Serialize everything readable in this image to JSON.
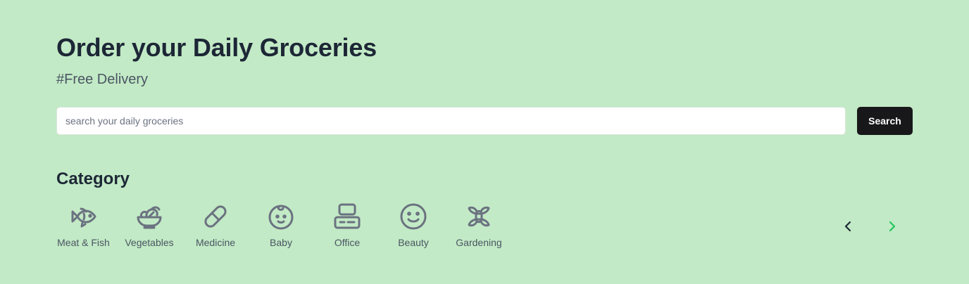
{
  "hero": {
    "title": "Order your Daily Groceries",
    "subtitle": "#Free Delivery"
  },
  "search": {
    "placeholder": "search your daily groceries",
    "value": "",
    "button_label": "Search"
  },
  "categories": {
    "heading": "Category",
    "items": [
      {
        "label": "Meat & Fish",
        "icon": "fish-icon"
      },
      {
        "label": "Vegetables",
        "icon": "salad-bowl-icon"
      },
      {
        "label": "Medicine",
        "icon": "pill-icon"
      },
      {
        "label": "Baby",
        "icon": "baby-face-icon"
      },
      {
        "label": "Office",
        "icon": "office-desk-icon"
      },
      {
        "label": "Beauty",
        "icon": "smiley-icon"
      },
      {
        "label": "Gardening",
        "icon": "flower-icon"
      }
    ],
    "nav": {
      "prev_icon": "chevron-left-icon",
      "next_icon": "chevron-right-icon"
    }
  },
  "colors": {
    "background": "#c2eac6",
    "heading": "#1d2736",
    "muted_text": "#4b5563",
    "icon": "#6b7280",
    "button_bg": "#18181b",
    "next_arrow": "#22c55e",
    "prev_arrow": "#1f2937"
  }
}
